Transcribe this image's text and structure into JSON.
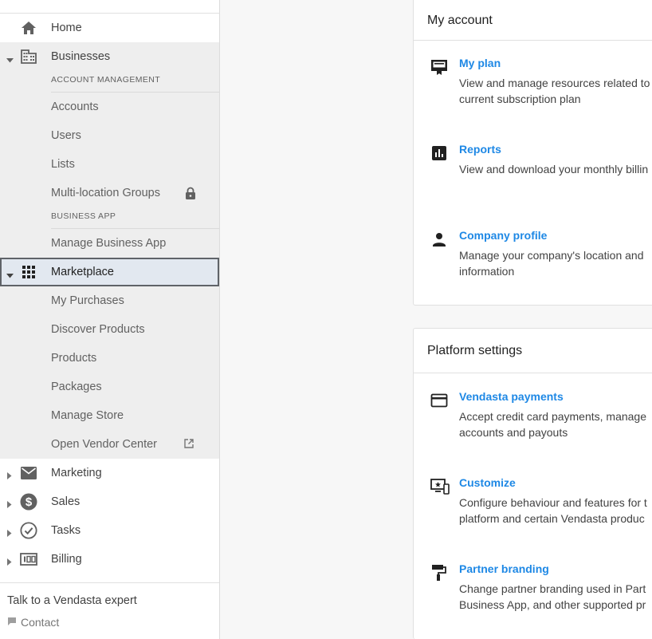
{
  "sidebar": {
    "home": "Home",
    "businesses": "Businesses",
    "account_management_label": "ACCOUNT MANAGEMENT",
    "business_items": [
      "Accounts",
      "Users",
      "Lists",
      "Multi-location Groups"
    ],
    "business_app_label": "BUSINESS APP",
    "manage_business_app": "Manage Business App",
    "marketplace": "Marketplace",
    "marketplace_items": [
      "My Purchases",
      "Discover Products",
      "Products",
      "Packages",
      "Manage Store",
      "Open Vendor Center"
    ],
    "marketing": "Marketing",
    "sales": "Sales",
    "tasks": "Tasks",
    "billing": "Billing",
    "footer_title": "Talk to a Vendasta expert",
    "footer_contact": "Contact"
  },
  "my_account": {
    "title": "My account",
    "items": [
      {
        "title": "My plan",
        "desc1": "View and manage resources related to",
        "desc2": "current subscription plan",
        "icon": "plan-icon"
      },
      {
        "title": "Reports",
        "desc1": "View and download your monthly billin",
        "desc2": "",
        "icon": "bar-chart-icon"
      },
      {
        "title": "Company profile",
        "desc1": "Manage your company's location and",
        "desc2": "information",
        "icon": "person-icon"
      }
    ]
  },
  "platform_settings": {
    "title": "Platform settings",
    "items": [
      {
        "title": "Vendasta payments",
        "desc1": "Accept credit card payments, manage",
        "desc2": "accounts and payouts",
        "icon": "credit-card-icon"
      },
      {
        "title": "Customize",
        "desc1": "Configure behaviour and features for t",
        "desc2": "platform and certain Vendasta produc",
        "icon": "customize-icon"
      },
      {
        "title": "Partner branding",
        "desc1": "Change partner branding used in Part",
        "desc2": "Business App, and other supported pr",
        "icon": "paint-roller-icon"
      }
    ]
  },
  "colors": {
    "link": "#1e88e5",
    "sidebar_grey": "#eeeeee",
    "selected": "#e2e8f0"
  }
}
